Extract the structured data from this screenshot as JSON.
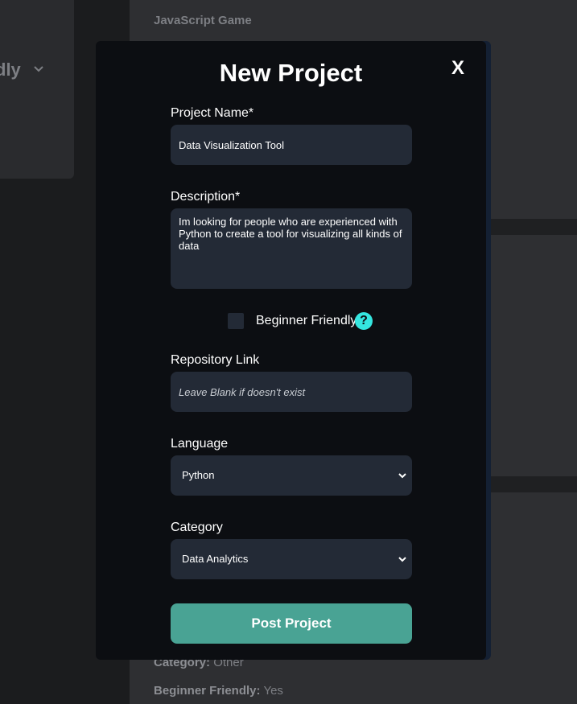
{
  "background": {
    "filter_label": "dly",
    "card_title": "JavaScript Game",
    "category_label": "Category:",
    "category_value": "Other",
    "beginner_label": "Beginner Friendly:",
    "beginner_value": "Yes"
  },
  "modal": {
    "title": "New Project",
    "close_label": "X",
    "project_name": {
      "label": "Project Name*",
      "value": "Data Visualization Tool"
    },
    "description": {
      "label": "Description*",
      "value": "Im looking for people who are experienced with Python to create a tool for visualizing all kinds of data"
    },
    "beginner_friendly": {
      "label": "Beginner Friendly",
      "checked": false,
      "help_glyph": "?"
    },
    "repository": {
      "label": "Repository Link",
      "value": "",
      "placeholder": "Leave Blank if doesn't exist"
    },
    "language": {
      "label": "Language",
      "selected": "Python"
    },
    "category": {
      "label": "Category",
      "selected": "Data Analytics"
    },
    "submit_label": "Post Project"
  },
  "colors": {
    "accent": "#49a394",
    "help_icon": "#35e6e0",
    "input_bg": "#232a36",
    "modal_bg": "#0c0e12"
  }
}
